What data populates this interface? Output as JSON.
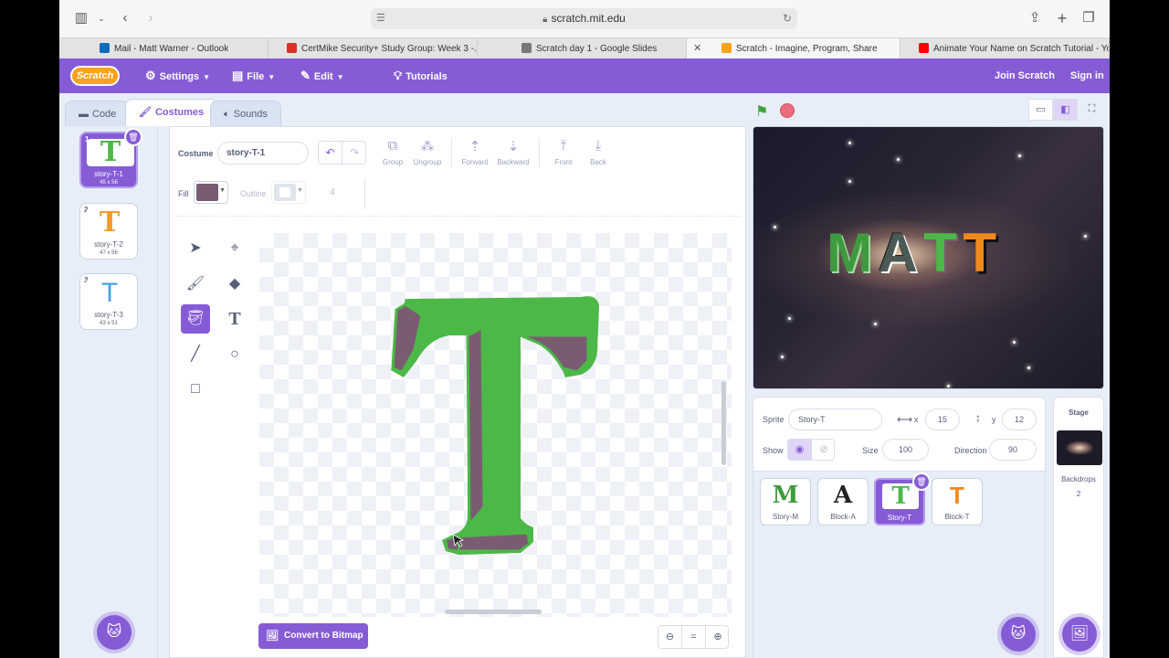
{
  "browser": {
    "url": "scratch.mit.edu",
    "tabs": [
      {
        "title": "Mail - Matt Warner - Outlook",
        "color": "#0f6cbd"
      },
      {
        "title": "CertMike Security+ Study Group: Week 3 -...",
        "color": "#d93025"
      },
      {
        "title": "Scratch day 1 - Google Slides",
        "color": "#777777"
      },
      {
        "title": "Scratch - Imagine, Program, Share",
        "color": "#f9a21a"
      },
      {
        "title": "Animate Your Name on Scratch Tutorial - Yo...",
        "color": "#ff0000"
      }
    ]
  },
  "menubar": {
    "logo": "Scratch",
    "settings": "Settings",
    "file": "File",
    "edit": "Edit",
    "tutorials": "Tutorials",
    "join": "Join Scratch",
    "signin": "Sign in"
  },
  "editor_tabs": {
    "code": "Code",
    "costumes": "Costumes",
    "sounds": "Sounds"
  },
  "costumes": [
    {
      "num": "1",
      "letter": "T",
      "name": "story-T-1",
      "size": "45 x 56",
      "color": "#4cb848"
    },
    {
      "num": "2",
      "letter": "T",
      "name": "story-T-2",
      "size": "47 x 56",
      "color": "#f39a2a"
    },
    {
      "num": "3",
      "letter": "T",
      "name": "story-T-3",
      "size": "43 x 51",
      "color": "#4aa4e0"
    }
  ],
  "paint": {
    "costume_label": "Costume",
    "costume_name": "story-T-1",
    "group": "Group",
    "ungroup": "Ungroup",
    "forward": "Forward",
    "backward": "Backward",
    "front": "Front",
    "back": "Back",
    "fill_label": "Fill",
    "fill_color": "#7a5c72",
    "outline_label": "Outline",
    "stroke_width": "4",
    "convert": "Convert to Bitmap",
    "letter_green": "#4cb848",
    "letter_shadow": "#7a5c72"
  },
  "stage": {
    "letters": [
      {
        "char": "M",
        "color": "#3e9a3e"
      },
      {
        "char": "A",
        "color": "#4b5a55"
      },
      {
        "char": "T",
        "color": "#4cb848"
      },
      {
        "char": "T",
        "color": "#f08a1c"
      }
    ]
  },
  "sprite_info": {
    "sprite_label": "Sprite",
    "sprite_name": "Story-T",
    "x_label": "x",
    "x": "15",
    "y_label": "y",
    "y": "12",
    "show_label": "Show",
    "size_label": "Size",
    "size": "100",
    "direction_label": "Direction",
    "direction": "90"
  },
  "sprites": [
    {
      "letter": "M",
      "name": "Story-M",
      "color": "#3e9a3e"
    },
    {
      "letter": "A",
      "name": "Block-A",
      "color": "#222222"
    },
    {
      "letter": "T",
      "name": "Story-T",
      "color": "#4cb848"
    },
    {
      "letter": "T",
      "name": "Block-T",
      "color": "#f08a1c"
    }
  ],
  "stage_panel": {
    "title": "Stage",
    "backdrops_label": "Backdrops",
    "backdrops_count": "2"
  }
}
